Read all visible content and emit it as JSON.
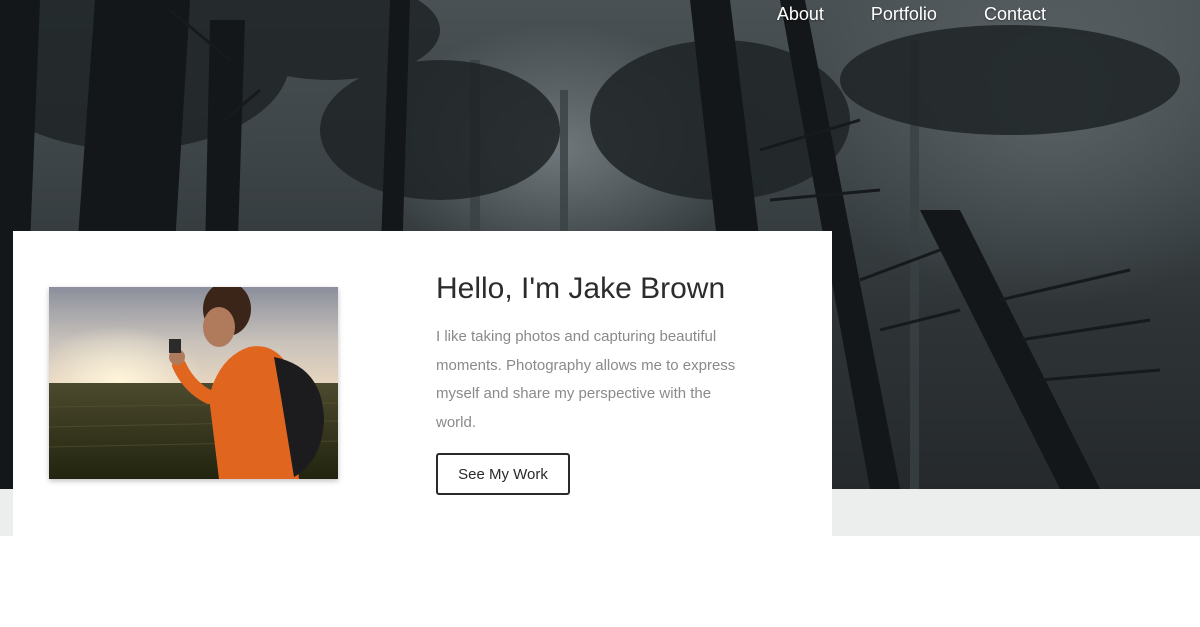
{
  "nav": {
    "items": [
      {
        "label": "About"
      },
      {
        "label": "Portfolio"
      },
      {
        "label": "Contact"
      }
    ]
  },
  "intro": {
    "title": "Hello, I'm Jake Brown",
    "text": "I like taking photos and capturing beautiful moments. Photography allows me to express myself and share my perspective with the world.",
    "button_label": "See My Work"
  },
  "colors": {
    "hero_dark": "#2e3436",
    "strip": "#eceeed",
    "card_bg": "#ffffff",
    "title": "#2c2c2c",
    "body_text": "#8a8a8a",
    "button_border": "#2a2a2a",
    "jacket_orange": "#e0661f"
  }
}
